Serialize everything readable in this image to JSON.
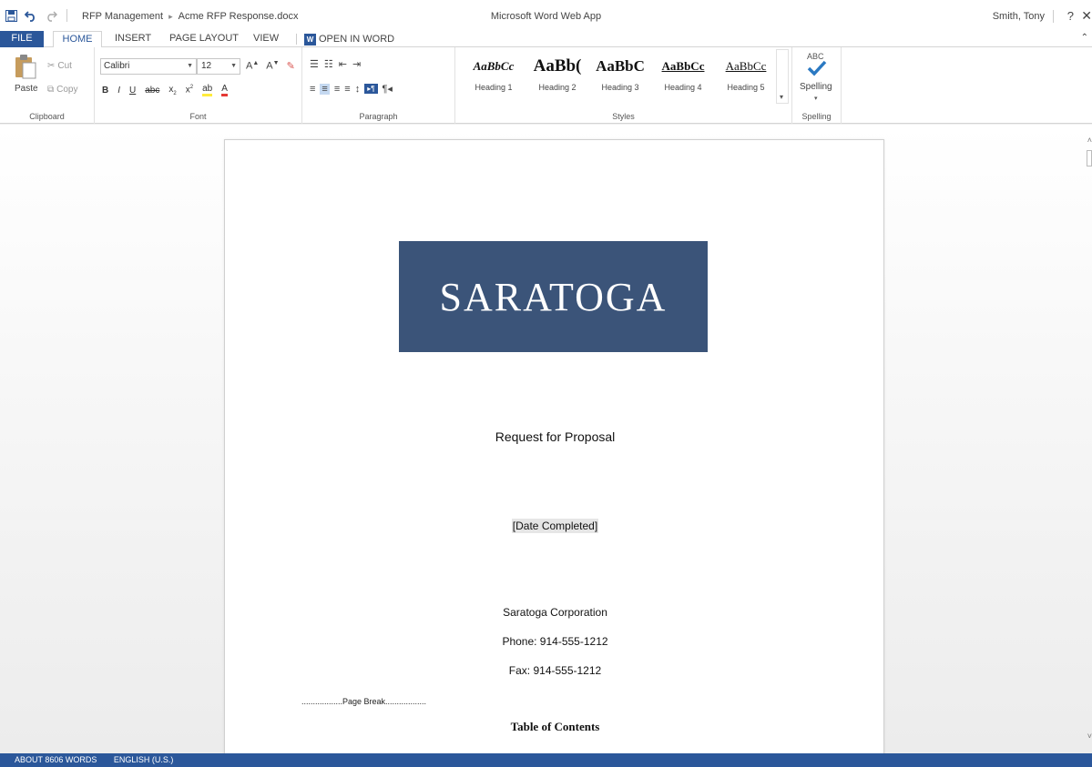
{
  "titlebar": {
    "breadcrumb_parent": "RFP Management",
    "breadcrumb_file": "Acme RFP Response.docx",
    "app_title": "Microsoft Word Web App",
    "user": "Smith, Tony",
    "help": "?",
    "close": "✕"
  },
  "tabs": {
    "file": "FILE",
    "home": "HOME",
    "insert": "INSERT",
    "page_layout": "PAGE LAYOUT",
    "view": "VIEW",
    "open_in_word": "OPEN IN WORD"
  },
  "ribbon": {
    "clipboard": {
      "paste": "Paste",
      "cut": "Cut",
      "copy": "Copy",
      "label": "Clipboard"
    },
    "font": {
      "name": "Calibri",
      "size": "12",
      "label": "Font"
    },
    "paragraph": {
      "label": "Paragraph"
    },
    "styles": {
      "label": "Styles",
      "items": [
        {
          "preview": "AaBbCc",
          "name": "Heading 1"
        },
        {
          "preview": "AaBb(",
          "name": "Heading 2"
        },
        {
          "preview": "AaBbC",
          "name": "Heading 3"
        },
        {
          "preview": "AaBbCc",
          "name": "Heading 4"
        },
        {
          "preview": "AaBbCc",
          "name": "Heading 5"
        }
      ]
    },
    "spelling": {
      "abc": "ABC",
      "button": "Spelling",
      "label": "Spelling"
    }
  },
  "document": {
    "logo_text": "SARATOGA",
    "title": "Request for Proposal",
    "date_placeholder": "[Date Completed]",
    "company": "Saratoga Corporation",
    "phone": "Phone: 914-555-1212",
    "fax": "Fax: 914-555-1212",
    "page_break": "..................Page Break..................",
    "toc_heading": "Table of Contents"
  },
  "status": {
    "word_count": "ABOUT 8606 WORDS",
    "language": "ENGLISH (U.S.)"
  },
  "colors": {
    "accent": "#2b579a",
    "logo_bg": "#3b5479"
  }
}
